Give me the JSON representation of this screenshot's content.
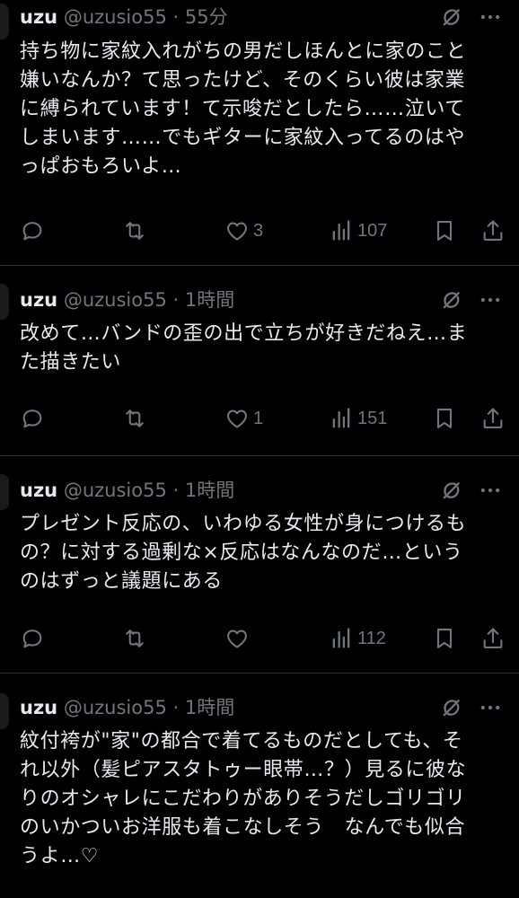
{
  "colors": {
    "background": "#000000",
    "text": "#e7e9ea",
    "muted": "#71767b",
    "divider": "#2f3336"
  },
  "tweets": [
    {
      "name": "uzu",
      "handle": "@uzusio55",
      "dot": "·",
      "time": "55分",
      "body": "持ち物に家紋入れがちの男だしほんとに家のこと\n嫌いなんか？て思ったけど、そのくらい彼は家業\nに縛られています！て示唆だとしたら……泣いて\nしまいます……でもギターに家紋入ってるのはや\nっぱおもろいよ…",
      "replies": "",
      "retweets": "",
      "likes": "3",
      "views": "107"
    },
    {
      "name": "uzu",
      "handle": "@uzusio55",
      "dot": "·",
      "time": "1時間",
      "body": "改めて…バンドの歪の出で立ちが好きだねえ…ま\nた描きたい",
      "replies": "",
      "retweets": "",
      "likes": "1",
      "views": "151"
    },
    {
      "name": "uzu",
      "handle": "@uzusio55",
      "dot": "·",
      "time": "1時間",
      "body": "プレゼント反応の、いわゆる女性が身につけるも\nの？に対する過剰な×反応はなんなのだ…という\nのはずっと議題にある",
      "replies": "",
      "retweets": "",
      "likes": "",
      "views": "112"
    },
    {
      "name": "uzu",
      "handle": "@uzusio55",
      "dot": "·",
      "time": "1時間",
      "body": "紋付袴が\"家\"の都合で着てるものだとしても、そ\nれ以外（髪ピアスタトゥー眼帯…？）見るに彼な\nりのオシャレにこだわりがありそうだしゴリゴリ\nのいかついお洋服も着こなしそう　なんでも似合\nうよ…♡"
    }
  ],
  "icons": {
    "reply": "reply-icon",
    "retweet": "retweet-icon",
    "like": "heart-icon",
    "views": "views-icon",
    "bookmark": "bookmark-icon",
    "share": "share-icon",
    "grok": "grok-icon",
    "more": "more-icon"
  }
}
